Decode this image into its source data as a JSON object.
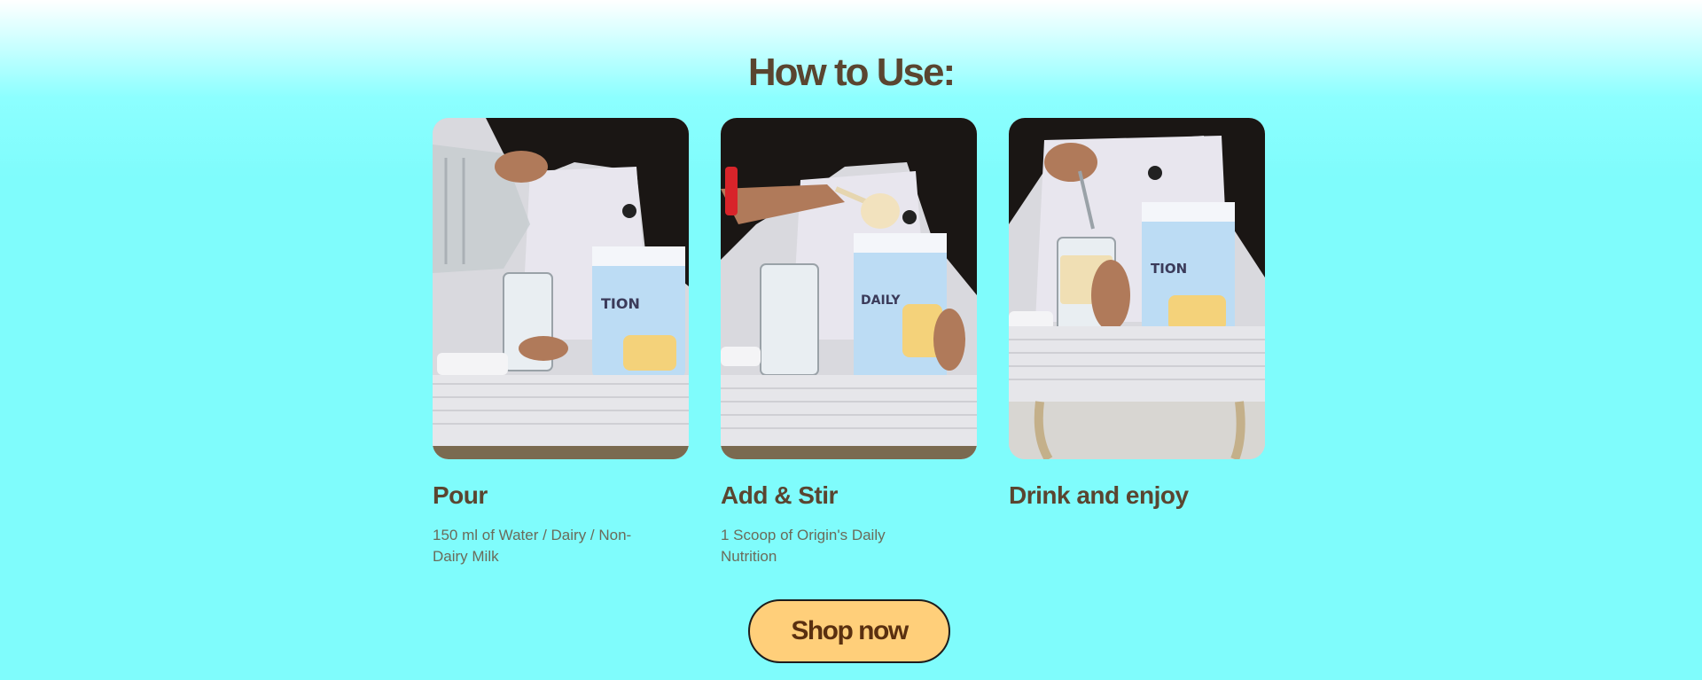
{
  "section": {
    "title": "How to Use:"
  },
  "steps": [
    {
      "title": "Pour",
      "description": "150 ml of Water / Dairy / Non-Dairy Milk",
      "image": "person-pouring-water-into-glass"
    },
    {
      "title": "Add & Stir",
      "description": "1 Scoop of Origin's Daily Nutrition",
      "image": "person-adding-scoop-of-powder"
    },
    {
      "title": "Drink and enjoy",
      "description": "",
      "image": "person-stirring-drink-with-spoon"
    }
  ],
  "cta": {
    "label": "Shop now"
  },
  "colors": {
    "background": "#7ffcfc",
    "heading": "#5a4530",
    "body_text": "#6b6b5a",
    "button_fill": "#ffcf7a",
    "button_border": "#1c1c1c"
  }
}
